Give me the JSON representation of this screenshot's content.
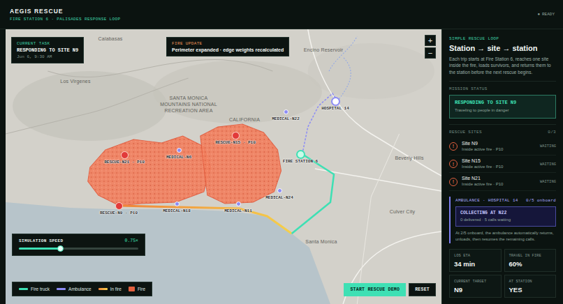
{
  "header": {
    "title": "AEGIS RESCUE",
    "subtitle": "FIRE STATION 6 · PALISADES RESPONSE LOOP",
    "status_icon": "●",
    "status": "READY"
  },
  "map": {
    "place_labels": [
      "Calabasas",
      "Los Virgenes",
      "Encino Reservoir",
      "SANTA MONICA MOUNTAINS NATIONAL RECREATION AREA",
      "CALIFORNIA",
      "Beverly Hills",
      "Santa Monica",
      "Culver City"
    ],
    "pins": [
      {
        "label": "RESCUE-N21 · P10",
        "kind": "rescue"
      },
      {
        "label": "RESCUE-N15 · P10",
        "kind": "rescue"
      },
      {
        "label": "RESCUE-N9 · P10",
        "kind": "rescue"
      },
      {
        "label": "MEDICAL-N6",
        "kind": "medical"
      },
      {
        "label": "MEDICAL-N22",
        "kind": "medical"
      },
      {
        "label": "MEDICAL-N18",
        "kind": "medical"
      },
      {
        "label": "MEDICAL-N11",
        "kind": "medical"
      },
      {
        "label": "MEDICAL-N24",
        "kind": "medical"
      },
      {
        "label": "FIRE STATION 6",
        "kind": "station"
      },
      {
        "label": "HOSPITAL 14",
        "kind": "hospital"
      }
    ],
    "current_task": {
      "heading": "CURRENT TASK",
      "value": "RESPONDING TO SITE N9",
      "time": "Jun 6, 9:30 AM"
    },
    "fire_update": {
      "heading": "FIRE UPDATE",
      "message": "Perimeter expanded · edge weights recalculated"
    },
    "zoom_buttons": [
      "+",
      "−"
    ],
    "speed": {
      "label": "SIMULATION SPEED",
      "reading": "0.75×",
      "level": 0.35
    },
    "legend": [
      {
        "label": "Fire truck",
        "kind": "line",
        "color": "#3ee0b4"
      },
      {
        "label": "Ambulance",
        "kind": "line",
        "color": "#8c8cf5"
      },
      {
        "label": "In fire",
        "kind": "gradient",
        "color": "#f0843a"
      },
      {
        "label": "Fire",
        "kind": "swatch",
        "color": "#e2603f"
      }
    ],
    "buttons": [
      {
        "label": "START RESCUE DEMO",
        "primary": true
      },
      {
        "label": "RESET",
        "primary": false
      }
    ]
  },
  "panel": {
    "eyebrow": "SIMPLE RESCUE LOOP",
    "title": "Station → site → station",
    "description": "Each trip starts at Fire Station 6, reaches one site inside the fire, loads survivors, and returns them to the station before the next rescue begins.",
    "mission": {
      "heading": "MISSION STATUS",
      "status": "RESPONDING TO SITE N9",
      "detail": "Traveling to people in danger"
    },
    "sites": {
      "heading": "RESCUE SITES",
      "count": "0/3",
      "items": [
        {
          "icon": "!",
          "name": "Site N9",
          "detail": "Inside active fire · P10",
          "status": "WAITING"
        },
        {
          "icon": "!",
          "name": "Site N15",
          "detail": "Inside active fire · P10",
          "status": "WAITING"
        },
        {
          "icon": "!",
          "name": "Site N21",
          "detail": "Inside active fire · P10",
          "status": "WAITING"
        }
      ]
    },
    "ambulance": {
      "heading": "AMBULANCE · HOSPITAL 14",
      "count": "0/5 onboard",
      "task": "COLLECTING AT N22",
      "task_detail": "0 delivered · 5 calls waiting",
      "note": "At 2/5 onboard, the ambulance automatically returns, unloads, then resumes the remaining calls."
    },
    "stats": [
      {
        "label": "LOS ETA",
        "value": "34 min"
      },
      {
        "label": "TRAVEL IN FIRE",
        "value": "60%"
      },
      {
        "label": "CURRENT TARGET",
        "value": "N9"
      },
      {
        "label": "AT STATION",
        "value": "YES"
      }
    ]
  }
}
